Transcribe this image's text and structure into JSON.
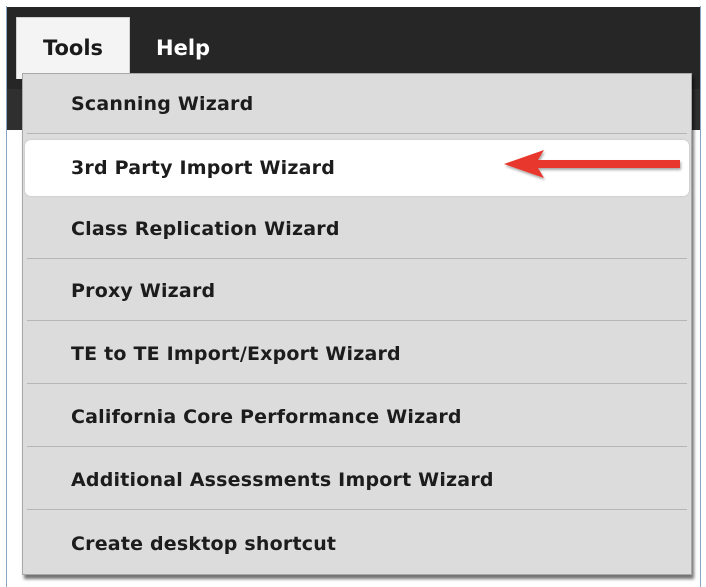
{
  "menubar": {
    "items": [
      {
        "label": "Tools"
      },
      {
        "label": "Help"
      }
    ]
  },
  "dropdown": {
    "items": [
      {
        "label": "Scanning Wizard"
      },
      {
        "label": "3rd Party Import Wizard",
        "highlighted": true
      },
      {
        "label": "Class Replication Wizard"
      },
      {
        "label": "Proxy Wizard"
      },
      {
        "label": "TE to TE Import/Export Wizard"
      },
      {
        "label": "California Core Performance Wizard"
      },
      {
        "label": "Additional Assessments Import Wizard"
      },
      {
        "label": "Create desktop shortcut"
      }
    ]
  },
  "colors": {
    "menubar_bg": "#262626",
    "dropdown_bg": "#dcdcdc",
    "highlight_bg": "#ffffff",
    "arrow": "#e8392f"
  },
  "annotations": {
    "arrow_icon": "red-arrow-left-icon"
  }
}
